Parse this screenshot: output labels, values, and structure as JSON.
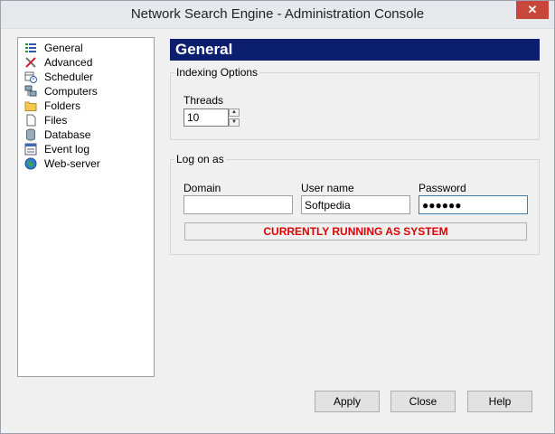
{
  "window": {
    "title": "Network Search Engine - Administration Console",
    "close_glyph": "✕"
  },
  "tree": {
    "items": [
      {
        "label": "General",
        "icon": "list-icon"
      },
      {
        "label": "Advanced",
        "icon": "tools-icon"
      },
      {
        "label": "Scheduler",
        "icon": "scheduler-icon"
      },
      {
        "label": "Computers",
        "icon": "computers-icon"
      },
      {
        "label": "Folders",
        "icon": "folder-icon"
      },
      {
        "label": "Files",
        "icon": "file-icon"
      },
      {
        "label": "Database",
        "icon": "database-icon"
      },
      {
        "label": "Event log",
        "icon": "event-log-icon"
      },
      {
        "label": "Web-server",
        "icon": "globe-icon"
      }
    ]
  },
  "panel": {
    "header": "General",
    "indexing": {
      "group_label": "Indexing Options",
      "threads_label": "Threads",
      "threads_value": "10"
    },
    "logon": {
      "group_label": "Log on as",
      "domain_label": "Domain",
      "domain_value": "",
      "username_label": "User name",
      "username_value": "Softpedia",
      "password_label": "Password",
      "password_value": "●●●●●●"
    },
    "status": "CURRENTLY RUNNING AS SYSTEM"
  },
  "buttons": {
    "apply": "Apply",
    "close": "Close",
    "help": "Help"
  },
  "colors": {
    "header_bg": "#0c1f6e",
    "status_text": "#e00000"
  }
}
